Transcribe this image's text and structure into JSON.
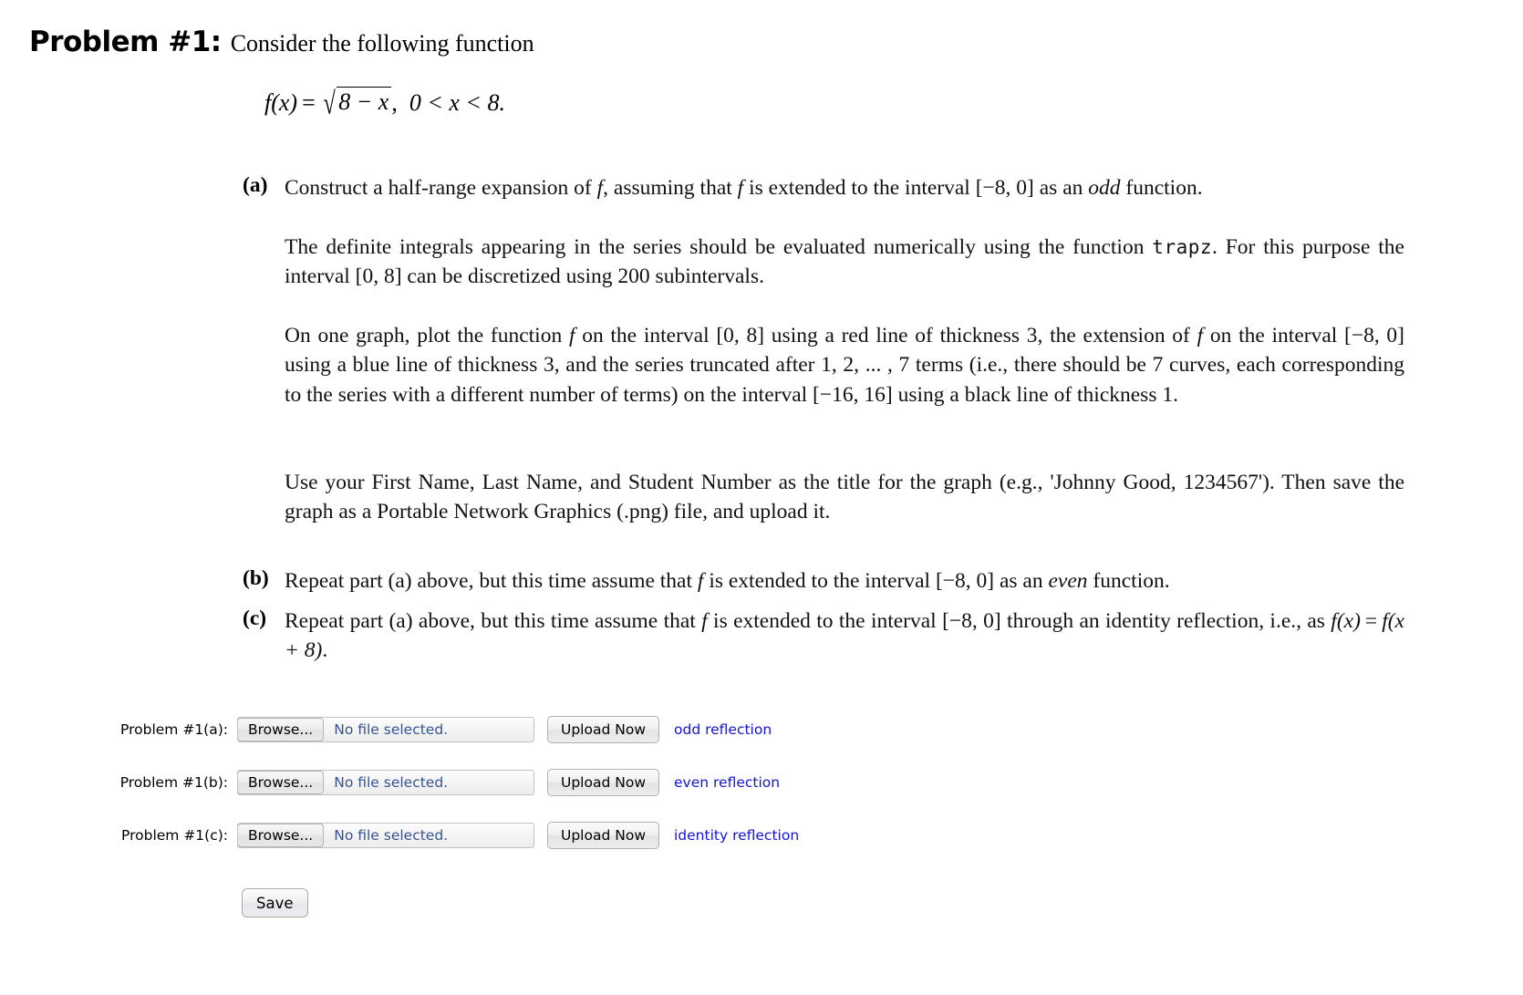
{
  "problem": {
    "label": "Problem #1:",
    "intro": "Consider the following function",
    "formula": {
      "lhs": "f(x)",
      "equals": "=",
      "sqrt_radicand": "8 − x",
      "comma": ",",
      "domain": "0 < x < 8."
    }
  },
  "items": {
    "a": {
      "marker": "(a)",
      "text_1": "Construct a half-range expansion of ",
      "f_1": "f",
      "text_2": ", assuming that ",
      "f_2": "f",
      "text_3": " is extended to the interval [−8, 0] as an ",
      "emph": "odd",
      "text_4": " function."
    },
    "a_para2": {
      "text_1": "The definite integrals appearing in the series should be evaluated numerically using the function ",
      "mono": "trapz",
      "text_2": ". For this purpose the interval [0, 8] can be discretized using 200 subintervals."
    },
    "a_para3": {
      "text_1": "On one graph, plot the function ",
      "f_1": "f",
      "text_2": " on the interval [0, 8] using a red line of thickness 3, the extension of ",
      "f_2": "f",
      "text_3": " on the interval [−8, 0] using a blue line of thickness 3, and the series truncated after 1, 2, ... , 7 terms (i.e., there should be 7 curves, each corresponding to the series with a different number of terms) on the interval [−16, 16] using a black line of thickness 1."
    },
    "a_para4": {
      "text": "Use your First Name, Last Name, and Student Number as the title for the graph (e.g., 'Johnny Good, 1234567'). Then save the graph as a Portable Network Graphics (.png) file, and upload it."
    },
    "b": {
      "marker": "(b)",
      "text_1": "Repeat part (a) above, but this time assume that ",
      "f_1": "f",
      "text_2": " is extended to the interval [−8, 0] as an ",
      "emph": "even",
      "text_3": " function."
    },
    "c": {
      "marker": "(c)",
      "text_1": "Repeat part (a) above, but this time assume that ",
      "f_1": "f",
      "text_2": " is extended to the interval [−8, 0] through an identity reflection, i.e., as ",
      "formula_1": "f(x)",
      "formula_eq": "=",
      "formula_2": "f(x + 8)",
      "text_3": "."
    }
  },
  "form": {
    "rows": [
      {
        "label": "Problem #1(a):",
        "browse_label": "Browse...",
        "file_status": "No file selected.",
        "upload_label": "Upload Now",
        "note": "odd reflection"
      },
      {
        "label": "Problem #1(b):",
        "browse_label": "Browse...",
        "file_status": "No file selected.",
        "upload_label": "Upload Now",
        "note": "even reflection"
      },
      {
        "label": "Problem #1(c):",
        "browse_label": "Browse...",
        "file_status": "No file selected.",
        "upload_label": "Upload Now",
        "note": "identity reflection"
      }
    ],
    "save_label": "Save"
  },
  "colors": {
    "note_blue": "#1414d6",
    "file_status_blue": "#36538f"
  }
}
